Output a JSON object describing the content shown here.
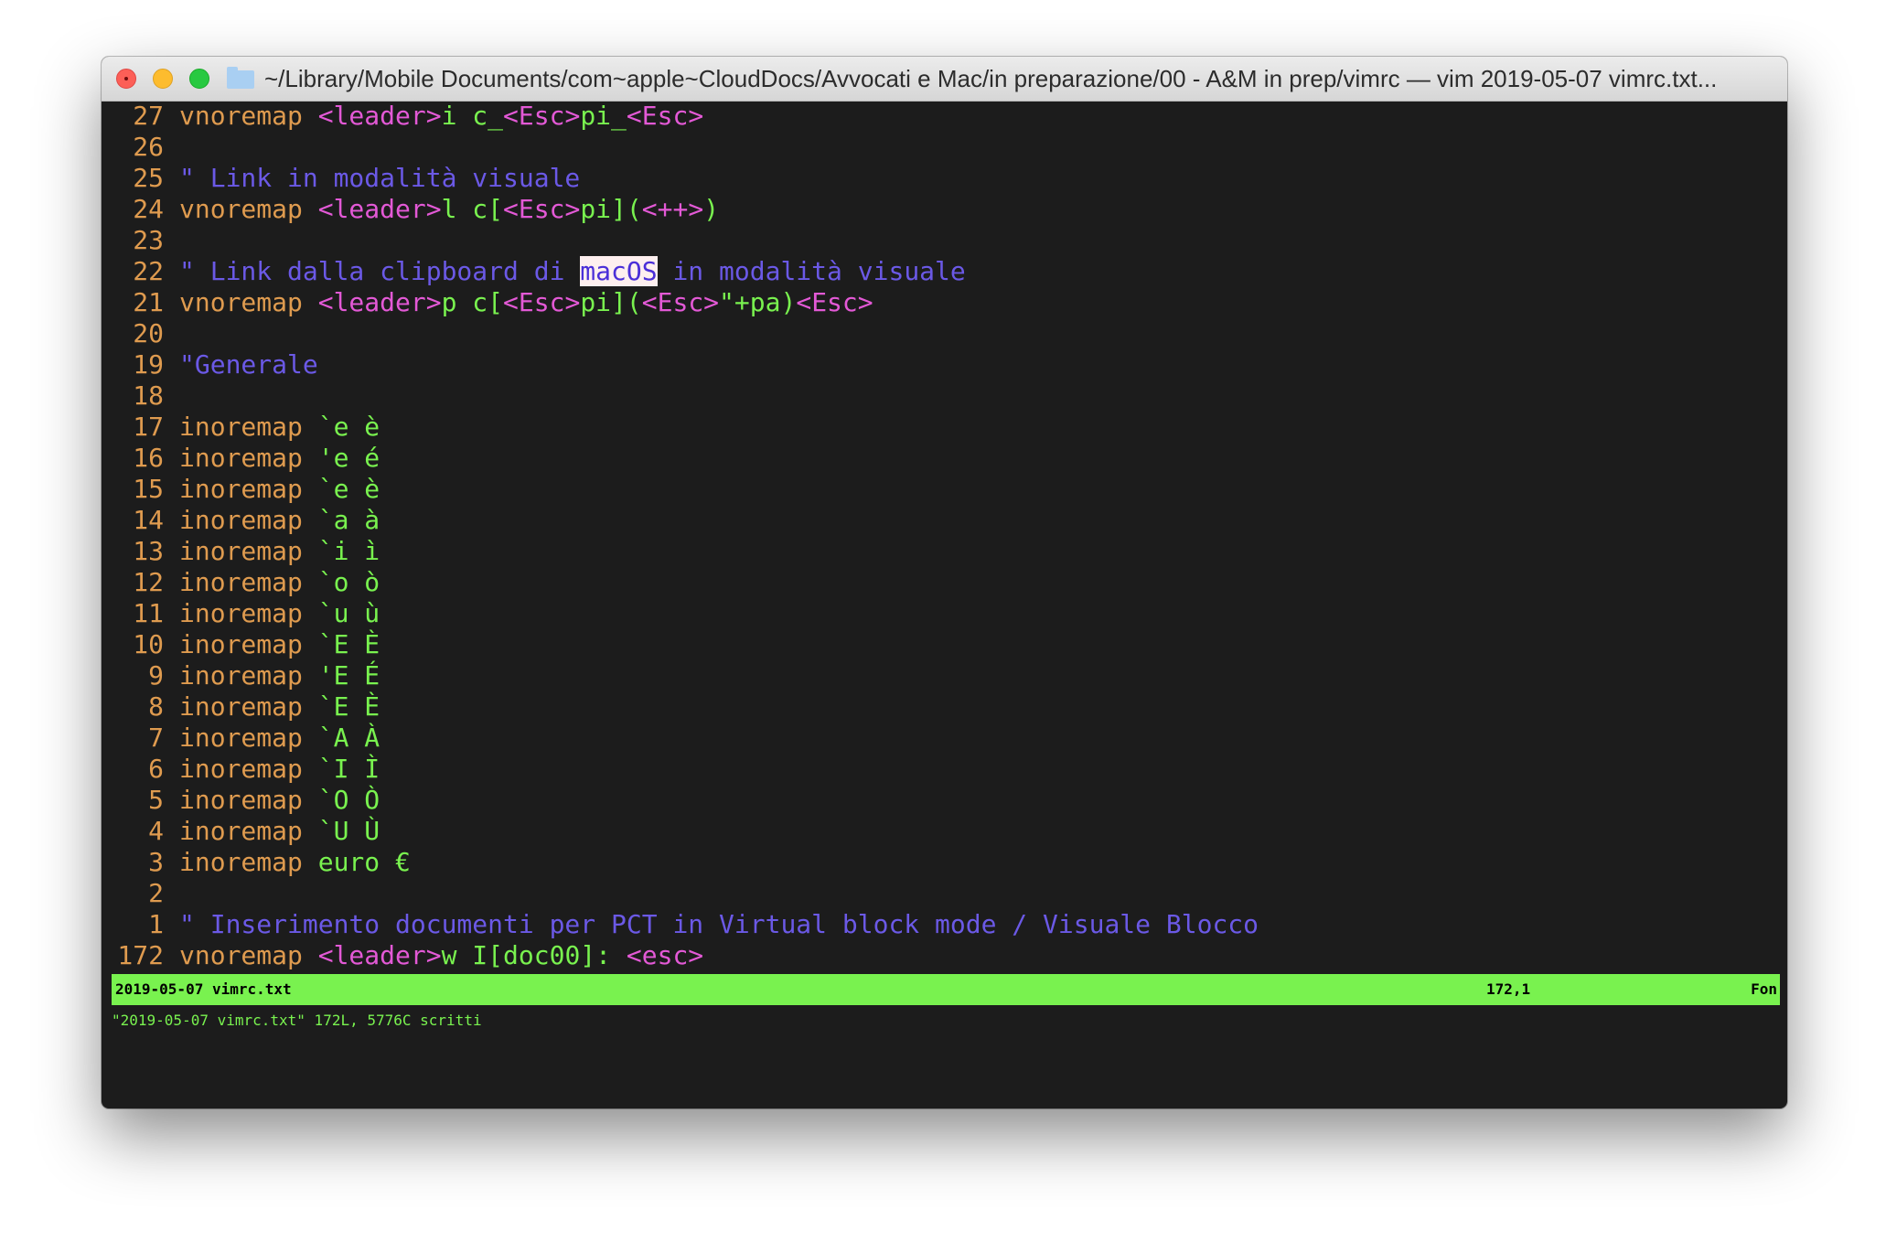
{
  "window": {
    "title": "~/Library/Mobile Documents/com~apple~CloudDocs/Avvocati e Mac/in preparazione/00 - A&M in prep/vimrc — vim 2019-05-07 vimrc.txt..."
  },
  "lines": [
    {
      "n": "27",
      "tokens": [
        {
          "t": "vnoremap ",
          "c": "kw"
        },
        {
          "t": "<leader>",
          "c": "mp"
        },
        {
          "t": "i c_",
          "c": "gr"
        },
        {
          "t": "<Esc>",
          "c": "mp"
        },
        {
          "t": "pi_",
          "c": "gr"
        },
        {
          "t": "<Esc>",
          "c": "mp"
        }
      ]
    },
    {
      "n": "26",
      "tokens": []
    },
    {
      "n": "25",
      "tokens": [
        {
          "t": "\" Link in modalità visuale",
          "c": "cm"
        }
      ]
    },
    {
      "n": "24",
      "tokens": [
        {
          "t": "vnoremap ",
          "c": "kw"
        },
        {
          "t": "<leader>",
          "c": "mp"
        },
        {
          "t": "l c[",
          "c": "gr"
        },
        {
          "t": "<Esc>",
          "c": "mp"
        },
        {
          "t": "pi](",
          "c": "gr"
        },
        {
          "t": "<++>",
          "c": "mp"
        },
        {
          "t": ")",
          "c": "gr"
        }
      ]
    },
    {
      "n": "23",
      "tokens": []
    },
    {
      "n": "22",
      "tokens": [
        {
          "t": "\" Link dalla clipboard di ",
          "c": "cm"
        },
        {
          "t": "macOS",
          "c": "hl"
        },
        {
          "t": " in modalità visuale",
          "c": "cm"
        }
      ]
    },
    {
      "n": "21",
      "tokens": [
        {
          "t": "vnoremap ",
          "c": "kw"
        },
        {
          "t": "<leader>",
          "c": "mp"
        },
        {
          "t": "p c[",
          "c": "gr"
        },
        {
          "t": "<Esc>",
          "c": "mp"
        },
        {
          "t": "pi](",
          "c": "gr"
        },
        {
          "t": "<Esc>",
          "c": "mp"
        },
        {
          "t": "\"+pa)",
          "c": "gr"
        },
        {
          "t": "<Esc>",
          "c": "mp"
        }
      ]
    },
    {
      "n": "20",
      "tokens": []
    },
    {
      "n": "19",
      "tokens": [
        {
          "t": "\"Generale",
          "c": "cm"
        }
      ]
    },
    {
      "n": "18",
      "tokens": []
    },
    {
      "n": "17",
      "tokens": [
        {
          "t": "inoremap ",
          "c": "kw"
        },
        {
          "t": "`e è",
          "c": "gr"
        }
      ]
    },
    {
      "n": "16",
      "tokens": [
        {
          "t": "inoremap ",
          "c": "kw"
        },
        {
          "t": "'e é",
          "c": "gr"
        }
      ]
    },
    {
      "n": "15",
      "tokens": [
        {
          "t": "inoremap ",
          "c": "kw"
        },
        {
          "t": "`e è",
          "c": "gr"
        }
      ]
    },
    {
      "n": "14",
      "tokens": [
        {
          "t": "inoremap ",
          "c": "kw"
        },
        {
          "t": "`a à",
          "c": "gr"
        }
      ]
    },
    {
      "n": "13",
      "tokens": [
        {
          "t": "inoremap ",
          "c": "kw"
        },
        {
          "t": "`i ì",
          "c": "gr"
        }
      ]
    },
    {
      "n": "12",
      "tokens": [
        {
          "t": "inoremap ",
          "c": "kw"
        },
        {
          "t": "`o ò",
          "c": "gr"
        }
      ]
    },
    {
      "n": "11",
      "tokens": [
        {
          "t": "inoremap ",
          "c": "kw"
        },
        {
          "t": "`u ù",
          "c": "gr"
        }
      ]
    },
    {
      "n": "10",
      "tokens": [
        {
          "t": "inoremap ",
          "c": "kw"
        },
        {
          "t": "`E È",
          "c": "gr"
        }
      ]
    },
    {
      "n": "9",
      "tokens": [
        {
          "t": "inoremap ",
          "c": "kw"
        },
        {
          "t": "'E É",
          "c": "gr"
        }
      ]
    },
    {
      "n": "8",
      "tokens": [
        {
          "t": "inoremap ",
          "c": "kw"
        },
        {
          "t": "`E È",
          "c": "gr"
        }
      ]
    },
    {
      "n": "7",
      "tokens": [
        {
          "t": "inoremap ",
          "c": "kw"
        },
        {
          "t": "`A À",
          "c": "gr"
        }
      ]
    },
    {
      "n": "6",
      "tokens": [
        {
          "t": "inoremap ",
          "c": "kw"
        },
        {
          "t": "`I Ì",
          "c": "gr"
        }
      ]
    },
    {
      "n": "5",
      "tokens": [
        {
          "t": "inoremap ",
          "c": "kw"
        },
        {
          "t": "`O Ò",
          "c": "gr"
        }
      ]
    },
    {
      "n": "4",
      "tokens": [
        {
          "t": "inoremap ",
          "c": "kw"
        },
        {
          "t": "`U Ù",
          "c": "gr"
        }
      ]
    },
    {
      "n": "3",
      "tokens": [
        {
          "t": "inoremap ",
          "c": "kw"
        },
        {
          "t": "euro €",
          "c": "gr"
        }
      ]
    },
    {
      "n": "2",
      "tokens": []
    },
    {
      "n": "1",
      "tokens": [
        {
          "t": "\" Inserimento documenti per PCT in Virtual block mode / Visuale Blocco",
          "c": "cm"
        }
      ]
    },
    {
      "n": "172",
      "tokens": [
        {
          "t": "vnoremap ",
          "c": "kw"
        },
        {
          "t": "<leader>",
          "c": "mp"
        },
        {
          "t": "w I[doc00]: ",
          "c": "gr"
        },
        {
          "t": "<esc>",
          "c": "mp"
        }
      ]
    }
  ],
  "status": {
    "filename": "2019-05-07 vimrc.txt",
    "position": "172,1",
    "scroll": "Fon"
  },
  "cmdline": "\"2019-05-07 vimrc.txt\" 172L, 5776C scritti",
  "colors": {
    "background": "#1c1c1c",
    "line_number": "#df9b4f",
    "keyword": "#df9b4f",
    "special": "#e359d6",
    "text": "#79f24f",
    "comment": "#6b59e6",
    "status_bar": "#79f24f",
    "search_highlight": "#fdefef"
  }
}
